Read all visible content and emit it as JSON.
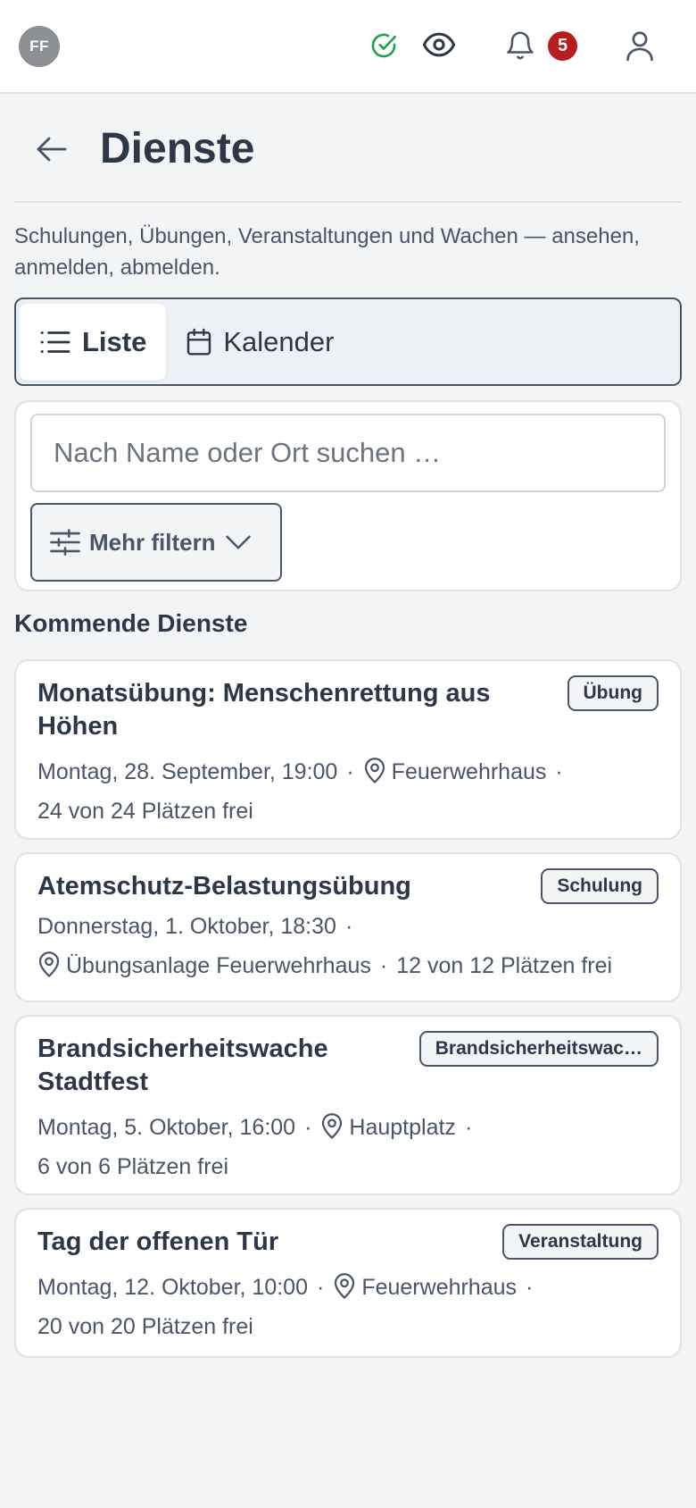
{
  "topbar": {
    "avatar_initials": "FF",
    "badge_count": "5",
    "icons": [
      "check-circle-icon",
      "eye-icon",
      "bell-icon",
      "user-icon"
    ]
  },
  "header": {
    "title": "Dienste",
    "subtitle": "Schulungen, Übungen, Veranstaltungen und Wachen — ansehen, anmelden, abmelden."
  },
  "tabs": [
    {
      "label": "Liste",
      "active": true
    },
    {
      "label": "Kalender",
      "active": false
    }
  ],
  "filter": {
    "search_placeholder": "Nach Name oder Ort suchen …",
    "more_filter_label": "Mehr filtern"
  },
  "section_title": "Kommende Dienste",
  "services": [
    {
      "title": "Monatsübung: Menschenrettung aus Höhen",
      "badge": "Übung",
      "date": "Montag, 28. September, 19:00",
      "location": "Feuerwehrhaus",
      "seats": "24 von 24 Plätzen frei"
    },
    {
      "title": "Atemschutz-Belastungsübung",
      "badge": "Schulung",
      "date": "Donnerstag, 1. Oktober, 18:30",
      "location": "Übungsanlage Feuerwehrhaus",
      "seats": "12 von 12 Plätzen frei"
    },
    {
      "title": "Brandsicherheitswache Stadtfest",
      "badge": "Brandsicherheitswac…",
      "date": "Montag, 5. Oktober, 16:00",
      "location": "Hauptplatz",
      "seats": "6 von 6 Plätzen frei"
    },
    {
      "title": "Tag der offenen Tür",
      "badge": "Veranstaltung",
      "date": "Montag, 12. Oktober, 10:00",
      "location": "Feuerwehrhaus",
      "seats": "20 von 20 Plätzen frei"
    }
  ],
  "colors": {
    "text": "#2d3748",
    "muted": "#4a5568",
    "success": "#16a34a",
    "badge_red": "#b91c1c",
    "background": "#f3f4f6"
  }
}
